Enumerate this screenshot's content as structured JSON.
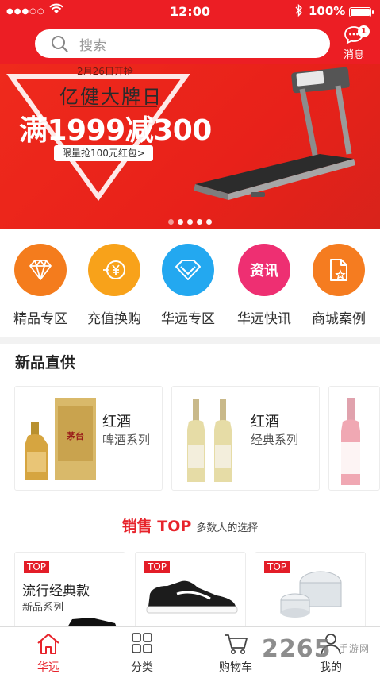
{
  "status_bar": {
    "signal": "●●●○○",
    "time": "12:00",
    "battery": "100%"
  },
  "search": {
    "placeholder": "搜索"
  },
  "messages": {
    "label": "消息",
    "count": "1"
  },
  "banner": {
    "date": "2月26日开抢",
    "brand": "亿健大牌日",
    "offer": "满1999减300",
    "coupon": "限量抢100元红包>",
    "slide_count": 5,
    "active_slide": 0
  },
  "categories": [
    {
      "label": "精品专区",
      "icon": "diamond-icon",
      "color": "#f47c1d"
    },
    {
      "label": "充值换购",
      "icon": "yen-exchange-icon",
      "color": "#f8a21a"
    },
    {
      "label": "华远专区",
      "icon": "gem-icon",
      "color": "#23a8f0"
    },
    {
      "label": "华远快讯",
      "icon": "news-text-icon",
      "text": "资讯",
      "color": "#ee2f72"
    },
    {
      "label": "商城案例",
      "icon": "document-star-icon",
      "color": "#f57c20"
    }
  ],
  "new_products": {
    "title": "新品直供",
    "items": [
      {
        "name": "红酒",
        "sub": "啤酒系列",
        "image": "baijiu-bottle-box"
      },
      {
        "name": "红酒",
        "sub": "经典系列",
        "image": "white-wine-bottles"
      },
      {
        "image": "rose-wine-bottle"
      }
    ]
  },
  "sales_top": {
    "title": "销售 TOP",
    "subtitle": "多数人的选择",
    "items": [
      {
        "tag": "TOP",
        "name": "流行经典款",
        "sub": "新品系列",
        "image": "shoe"
      },
      {
        "tag": "TOP",
        "image": "black-sneaker"
      },
      {
        "tag": "TOP",
        "image": "crystal-jar"
      }
    ]
  },
  "tabbar": [
    {
      "label": "华远",
      "icon": "home-icon",
      "active": true
    },
    {
      "label": "分类",
      "icon": "grid-icon",
      "active": false
    },
    {
      "label": "购物车",
      "icon": "cart-icon",
      "active": false
    },
    {
      "label": "我的",
      "icon": "user-icon",
      "active": false
    }
  ],
  "watermark": {
    "number": "2265",
    "site": "手游网"
  },
  "colors": {
    "brand_red": "#ec1e24",
    "accent_red": "#e7232b"
  }
}
